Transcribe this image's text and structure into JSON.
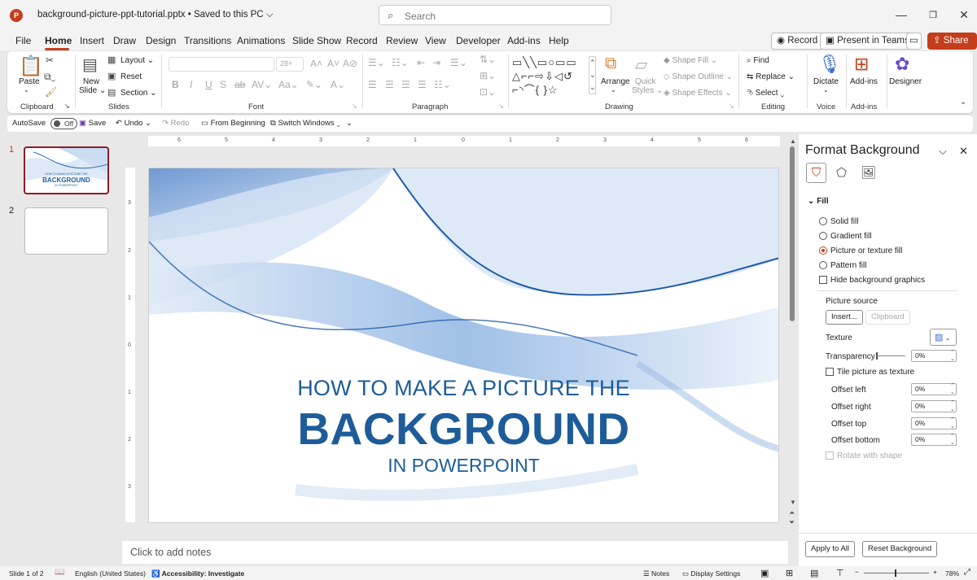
{
  "titlebar": {
    "app_icon": "P",
    "doc_title": "background-picture-ppt-tutorial.pptx • Saved to this PC",
    "search_placeholder": "Search"
  },
  "tabs": [
    "File",
    "Home",
    "Insert",
    "Draw",
    "Design",
    "Transitions",
    "Animations",
    "Slide Show",
    "Record",
    "Review",
    "View",
    "Developer",
    "Add-ins",
    "Help"
  ],
  "tab_actions": {
    "record": "Record",
    "present": "Present in Teams",
    "share": "Share"
  },
  "ribbon": {
    "clipboard": {
      "paste": "Paste",
      "label": "Clipboard"
    },
    "slides": {
      "new_slide": "New",
      "new_slide2": "Slide",
      "layout": "Layout",
      "reset": "Reset",
      "section": "Section",
      "label": "Slides"
    },
    "font": {
      "label": "Font",
      "size": "28+"
    },
    "paragraph": {
      "label": "Paragraph"
    },
    "drawing": {
      "arrange": "Arrange",
      "quick_styles": "Quick",
      "quick_styles2": "Styles",
      "shape_fill": "Shape Fill",
      "shape_outline": "Shape Outline",
      "shape_effects": "Shape Effects",
      "label": "Drawing"
    },
    "editing": {
      "find": "Find",
      "replace": "Replace",
      "select": "Select",
      "label": "Editing"
    },
    "voice": {
      "dictate": "Dictate",
      "label": "Voice"
    },
    "addins": {
      "addins": "Add-ins",
      "label": "Add-ins"
    },
    "designer": {
      "designer": "Designer"
    }
  },
  "qat": {
    "autosave": "AutoSave",
    "toggle": "Off",
    "save": "Save",
    "undo": "Undo",
    "redo": "Redo",
    "from_beginning": "From Beginning",
    "switch_windows": "Switch Windows"
  },
  "thumbnails": [
    {
      "num": "1"
    },
    {
      "num": "2"
    }
  ],
  "ruler": {
    "h": [
      "6",
      "5",
      "4",
      "3",
      "2",
      "1",
      "0",
      "1",
      "2",
      "3",
      "4",
      "5",
      "6"
    ],
    "v": [
      "3",
      "2",
      "1",
      "0",
      "1",
      "2",
      "3"
    ]
  },
  "slide": {
    "line1": "HOW TO MAKE A PICTURE THE",
    "line2": "BACKGROUND",
    "line3": "IN POWERPOINT"
  },
  "thumb1": {
    "line1": "HOW TO MAKE A PICTURE THE",
    "line2": "BACKGROUND",
    "line3": "IN POWERPOINT"
  },
  "notes_placeholder": "Click to add notes",
  "pane": {
    "title": "Format Background",
    "fill_header": "Fill",
    "options": [
      "Solid fill",
      "Gradient fill",
      "Picture or texture fill",
      "Pattern fill"
    ],
    "selected_option": "Picture or texture fill",
    "hide_bg": "Hide background graphics",
    "picture_source": "Picture source",
    "insert": "Insert...",
    "clipboard": "Clipboard",
    "texture": "Texture",
    "transparency": "Transparency",
    "transparency_value": "0%",
    "tile": "Tile picture as texture",
    "offsets": [
      {
        "label": "Offset left",
        "value": "0%"
      },
      {
        "label": "Offset right",
        "value": "0%"
      },
      {
        "label": "Offset top",
        "value": "0%"
      },
      {
        "label": "Offset bottom",
        "value": "0%"
      }
    ],
    "rotate": "Rotate with shape",
    "apply_all": "Apply to All",
    "reset_bg": "Reset Background"
  },
  "status": {
    "slide": "Slide 1 of 2",
    "lang": "English (United States)",
    "accessibility": "Accessibility: Investigate",
    "notes": "Notes",
    "display": "Display Settings",
    "zoom": "78%"
  },
  "colors": {
    "accent": "#c43e1c",
    "slide_text": "#1e5c99"
  }
}
